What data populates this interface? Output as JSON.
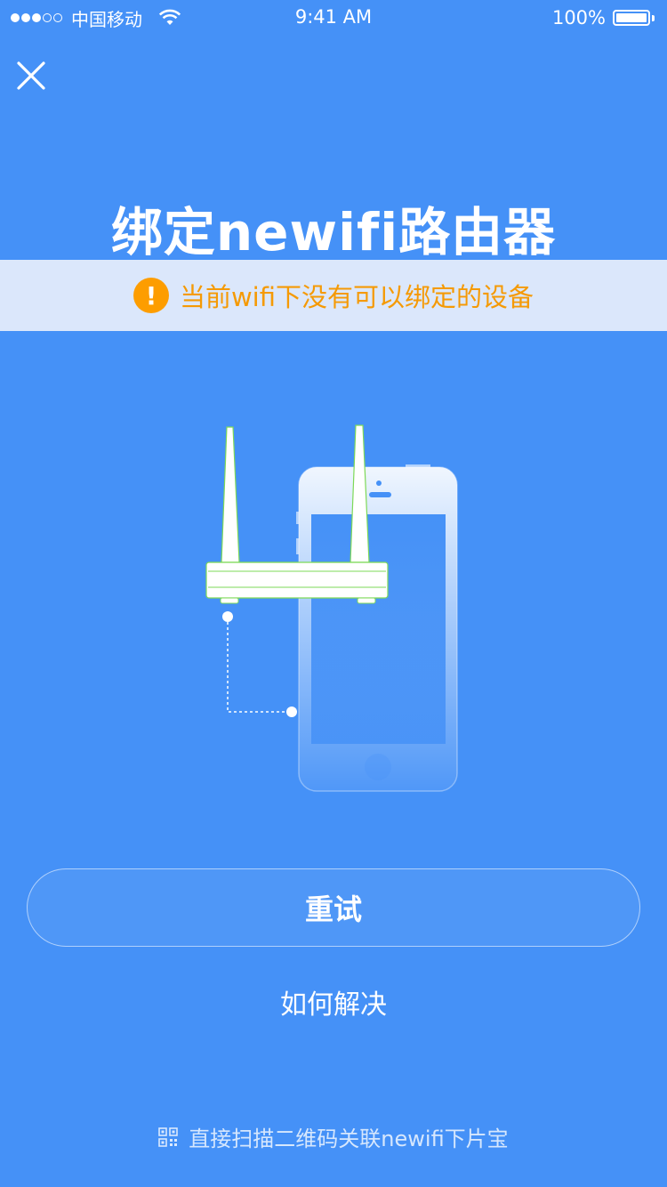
{
  "status_bar": {
    "carrier": "中国移动",
    "time": "9:41 AM",
    "battery": "100%",
    "signal_bars_filled": 3,
    "signal_bars_total": 5
  },
  "header": {
    "close_icon": "close-icon",
    "title": "绑定newifi路由器"
  },
  "warning": {
    "icon": "exclamation-icon",
    "icon_glyph": "!",
    "text": "当前wifi下没有可以绑定的设备",
    "color": "#f59a05"
  },
  "illustration": {
    "router_icon": "router-icon",
    "phone_icon": "phone-icon"
  },
  "actions": {
    "retry_label": "重试",
    "help_label": "如何解决"
  },
  "footer": {
    "qr_icon": "qr-code-icon",
    "scan_text": "直接扫描二维码关联newifi下片宝"
  },
  "colors": {
    "background": "#4591f7",
    "banner": "#dbe7fb",
    "warning_accent": "#fd9d00"
  }
}
